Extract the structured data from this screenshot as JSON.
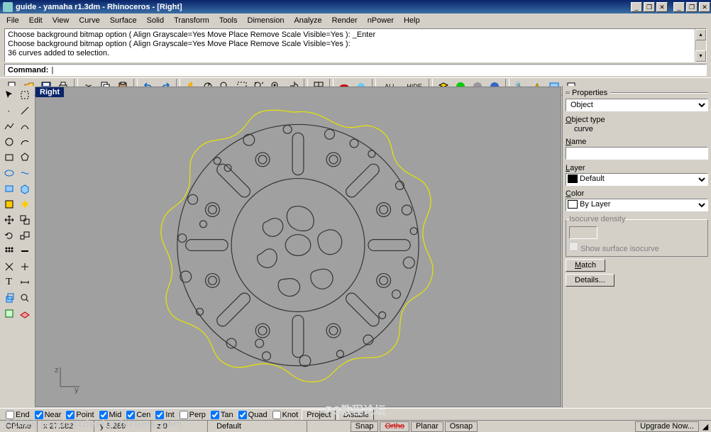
{
  "window": {
    "title": "guide - yamaha r1.3dm - Rhinoceros - [Right]"
  },
  "menus": [
    "File",
    "Edit",
    "View",
    "Curve",
    "Surface",
    "Solid",
    "Transform",
    "Tools",
    "Dimension",
    "Analyze",
    "Render",
    "nPower",
    "Help"
  ],
  "history": [
    "Choose background bitmap option ( Align  Grayscale=Yes  Move  Place  Remove  Scale  Visible=Yes ):  _Enter",
    "Choose background bitmap option ( Align  Grayscale=Yes  Move  Place  Remove  Scale  Visible=Yes ):",
    "36 curves added to selection."
  ],
  "command_prompt": "Command:",
  "viewport_label": "Right",
  "axis": {
    "v": "z",
    "h": "y"
  },
  "properties": {
    "title": "Properties",
    "selector": "Object",
    "object_type_label": "Object type",
    "object_type": "curve",
    "name_label": "Name",
    "name": "",
    "layer_label": "Layer",
    "layer": "Default",
    "color_label": "Color",
    "color": "By Layer",
    "iso_group": "Isocurve density",
    "iso_checkbox": "Show surface isocurve",
    "match_btn": "Match",
    "details_btn": "Details..."
  },
  "osnap": {
    "items": [
      {
        "label": "End",
        "on": false
      },
      {
        "label": "Near",
        "on": true
      },
      {
        "label": "Point",
        "on": true
      },
      {
        "label": "Mid",
        "on": true
      },
      {
        "label": "Cen",
        "on": true
      },
      {
        "label": "Int",
        "on": true
      },
      {
        "label": "Perp",
        "on": false
      },
      {
        "label": "Tan",
        "on": true
      },
      {
        "label": "Quad",
        "on": true
      },
      {
        "label": "Knot",
        "on": false
      }
    ],
    "project": "Project",
    "disable": "Disable"
  },
  "status": {
    "cplane": "CPlane",
    "x": "x 27.382",
    "y": "y 5.289",
    "z": "z 0",
    "layer": "Default",
    "panes": [
      "Snap",
      "Ortho",
      "Planar",
      "Osnap"
    ],
    "upgrade": "Upgrade Now..."
  },
  "watermark": "©2008 productdesignforums.com",
  "watermark2": "PS教程论坛"
}
